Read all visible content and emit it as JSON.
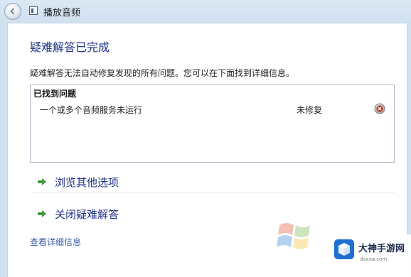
{
  "window": {
    "title": "播放音频"
  },
  "main": {
    "heading": "疑难解答已完成",
    "description": "疑难解答无法自动修复发现的所有问题。您可以在下面找到详细信息。",
    "problems": {
      "header": "已找到问题",
      "rows": [
        {
          "name": "一个或多个音频服务未运行",
          "status": "未修复",
          "status_icon": "error-icon"
        }
      ]
    },
    "links": [
      {
        "label": "浏览其他选项",
        "icon": "green-arrow-icon"
      },
      {
        "label": "关闭疑难解答",
        "icon": "green-arrow-icon"
      }
    ],
    "details_link": "查看详细信息"
  },
  "watermark": {
    "site_name": "大神手游网",
    "site_url": "dsxsw.com"
  },
  "colors": {
    "heading": "#1e3287",
    "link": "#3a5ea8",
    "arrow": "#3c9a3c",
    "error": "#c0392b"
  }
}
